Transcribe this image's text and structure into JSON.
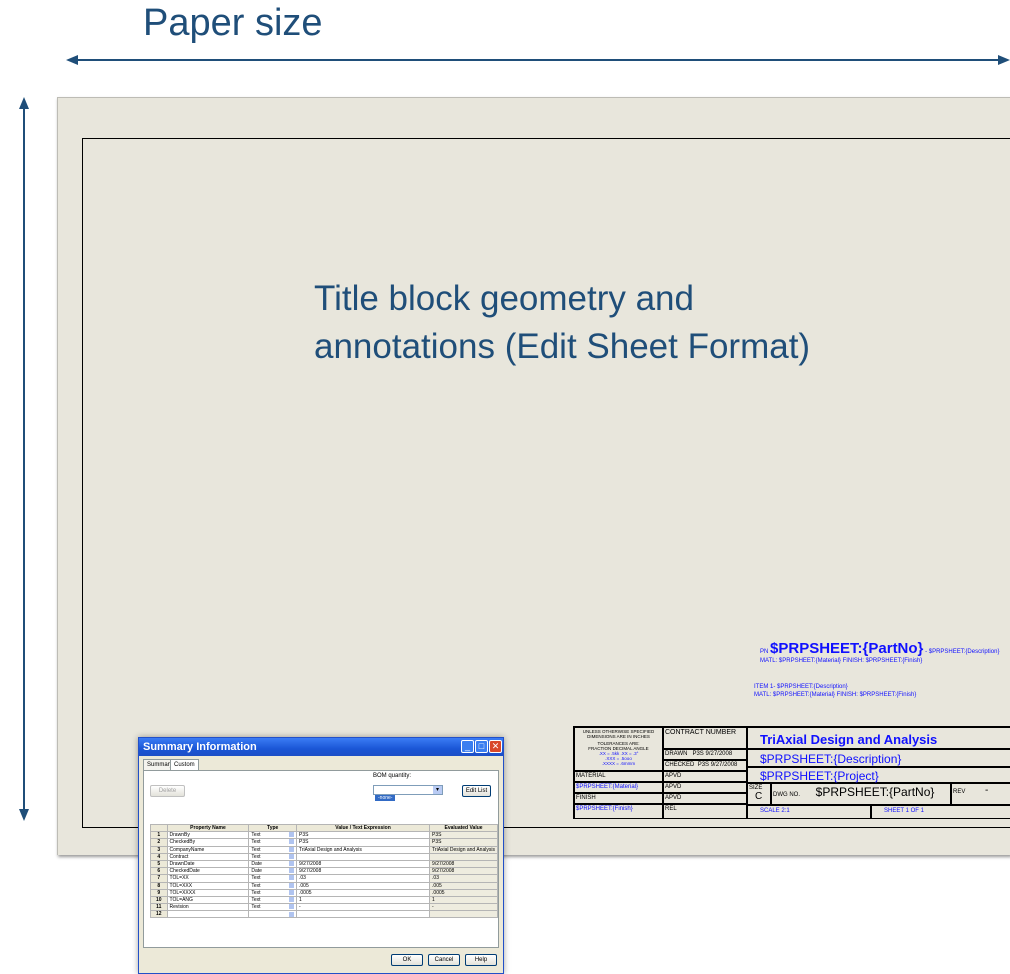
{
  "labels": {
    "paper_size": "Paper size",
    "edit_sheet_format": "Title block geometry and annotations (Edit Sheet Format)"
  },
  "annotations": {
    "pn_prefix": "PN",
    "pn_value": "$PRPSHEET:{PartNo}",
    "pn_suffix": "- $PRPSHEET:{Description}",
    "matl_line": "MATL: $PRPSHEET:{Material}   FINISH: $PRPSHEET:{Finish}",
    "item_line1": "ITEM 1- $PRPSHEET:{Description}",
    "item_line2": "MATL: $PRPSHEET:{Material}   FINISH: $PRPSHEET:{Finish}"
  },
  "title_block": {
    "tolerances_note": "UNLESS OTHERWISE SPECIFIED DIMENSIONS ARE IN INCHES",
    "tolerances_are": "TOLERANCES ARE:",
    "fraction": "FRACTION",
    "decimal": "DECIMAL",
    "angle": "ANGLE",
    "tol_line1": ".XX = .5kk   .XX = .3°",
    "tol_line2": ".XXX = .5ooo",
    "tol_line3": ".XXXX = .6mmm",
    "contract_number": "CONTRACT NUMBER",
    "company": "TriAxial Design and Analysis",
    "drawn": "DRAWN",
    "drawn_value": "P3S 9/27/2008",
    "checked": "CHECKED",
    "checked_value": "P3S 9/27/2008",
    "material": "MATERIAL",
    "material_value": "$PRPSHEET:{Material}",
    "finish": "FINISH",
    "finish_value": "$PRPSHEET:{Finish}",
    "apvd1": "APVD",
    "apvd2": "APVD",
    "apvd3": "APVD",
    "rel": "REL",
    "description": "$PRPSHEET:{Description}",
    "project": "$PRPSHEET:{Project}",
    "size_label": "SIZE",
    "size_value": "C",
    "dwg_no_label": "DWG NO.",
    "dwg_no_value": "$PRPSHEET:{PartNo}",
    "rev_label": "REV",
    "rev_value": "-",
    "scale": "SCALE 2:1",
    "sheet": "SHEET 1 OF 1"
  },
  "dialog": {
    "title": "Summary Information",
    "tabs": [
      "Summary",
      "Custom"
    ],
    "active_tab": "Custom",
    "delete_label": "Delete",
    "bom_label": "BOM quantity:",
    "bom_value": "-none-",
    "edit_list_label": "Edit List",
    "columns": [
      "",
      "Property Name",
      "Type",
      "Value / Text Expression",
      "Evaluated Value"
    ],
    "rows": [
      {
        "n": "1",
        "name": "DrawnBy",
        "type": "Text",
        "value": "P3S",
        "eval": "P3S"
      },
      {
        "n": "2",
        "name": "CheckedBy",
        "type": "Text",
        "value": "P3S",
        "eval": "P3S"
      },
      {
        "n": "3",
        "name": "CompanyName",
        "type": "Text",
        "value": "TriAxial Design and Analysis",
        "eval": "TriAxial Design and Analysis"
      },
      {
        "n": "4",
        "name": "Contract",
        "type": "Text",
        "value": "",
        "eval": ""
      },
      {
        "n": "5",
        "name": "DrawnDate",
        "type": "Date",
        "value": "9/27/2008",
        "eval": "9/27/2008"
      },
      {
        "n": "6",
        "name": "CheckedDate",
        "type": "Date",
        "value": "9/27/2008",
        "eval": "9/27/2008"
      },
      {
        "n": "7",
        "name": "TOL=XX",
        "type": "Text",
        "value": ".03",
        "eval": ".03"
      },
      {
        "n": "8",
        "name": "TOL=XXX",
        "type": "Text",
        "value": ".005",
        "eval": ".005"
      },
      {
        "n": "9",
        "name": "TOL=XXXX",
        "type": "Text",
        "value": ".0005",
        "eval": ".0005"
      },
      {
        "n": "10",
        "name": "TOL=ANG",
        "type": "Text",
        "value": "1",
        "eval": "1"
      },
      {
        "n": "11",
        "name": "Revision",
        "type": "Text",
        "value": "-",
        "eval": "-"
      },
      {
        "n": "12",
        "name": "",
        "type": "",
        "value": "",
        "eval": ""
      }
    ],
    "ok_label": "OK",
    "cancel_label": "Cancel",
    "help_label": "Help"
  }
}
